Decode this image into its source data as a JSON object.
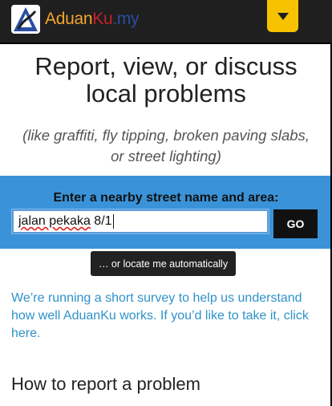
{
  "header": {
    "logo": {
      "part_a": "Aduan",
      "part_b": "Ku",
      "part_c": ".my"
    },
    "menu_icon": "chevron-down-icon",
    "colors": {
      "bar": "#1f1f1f",
      "menu": "#f7c300"
    }
  },
  "hero": {
    "title_line1": "Report, view, or discuss",
    "title_line2": "local problems",
    "subtitle_line1": "(like graffiti, fly tipping, broken paving slabs,",
    "subtitle_line2": "or street lighting)"
  },
  "search": {
    "label": "Enter a nearby street name and area:",
    "value_spellcheck_word": "jalan pekaka",
    "value_rest": " 8/1",
    "go_label": "GO",
    "band_color": "#3a93d8"
  },
  "locate": {
    "label": "… or locate me automatically"
  },
  "survey": {
    "text_line1": "We’re running a short survey to help us understand",
    "text_line2": "how well AduanKu works. If you’d like to take it, click",
    "text_line3": "here."
  },
  "howto": {
    "heading": "How to report a problem"
  }
}
